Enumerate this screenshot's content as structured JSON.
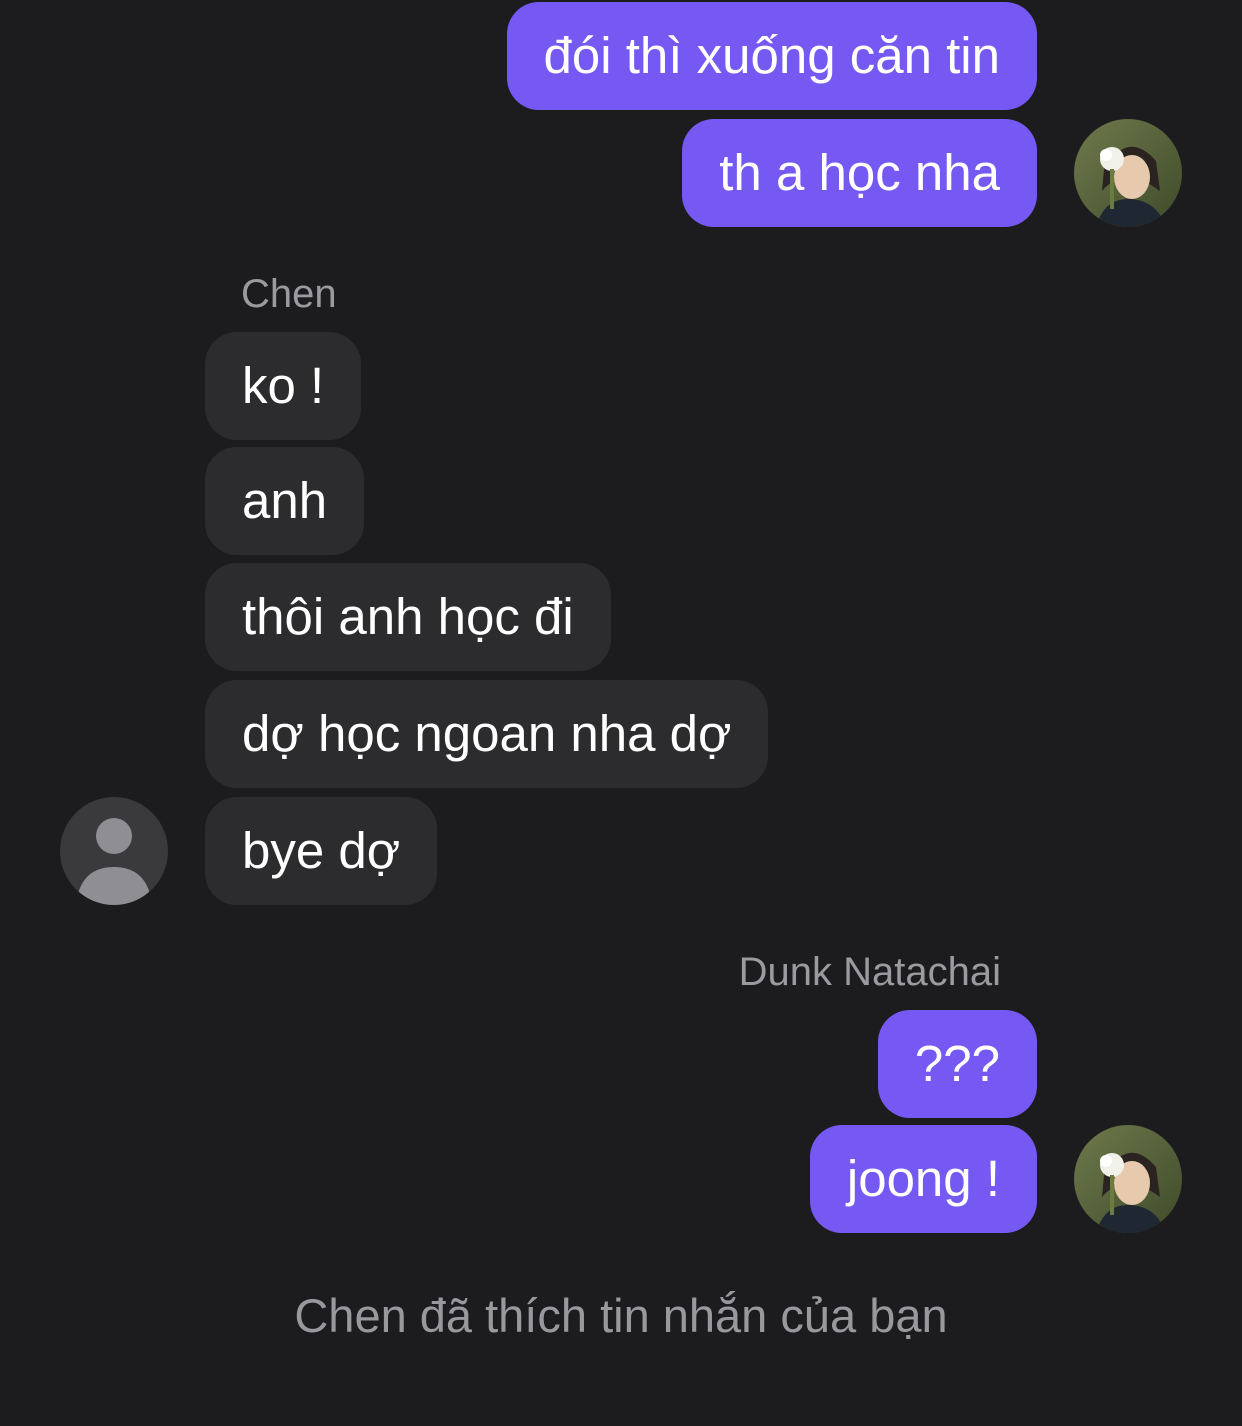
{
  "conversation": {
    "messages": [
      {
        "direction": "outgoing",
        "text": "đói thì xuống căn tin"
      },
      {
        "direction": "outgoing",
        "text": "th a học nha"
      },
      {
        "direction": "incoming",
        "sender": "Chen",
        "text": "ko !"
      },
      {
        "direction": "incoming",
        "text": "anh"
      },
      {
        "direction": "incoming",
        "text": "thôi anh học đi"
      },
      {
        "direction": "incoming",
        "text": "dợ học ngoan nha dợ"
      },
      {
        "direction": "incoming",
        "text": "bye dợ"
      },
      {
        "direction": "outgoing",
        "sender": "Dunk Natachai",
        "text": "???"
      },
      {
        "direction": "outgoing",
        "text": "joong !"
      }
    ],
    "sender_labels": {
      "incoming": "Chen",
      "outgoing": "Dunk Natachai"
    },
    "like_notice": "Chen đã thích tin nhắn của bạn"
  },
  "colors": {
    "background": "#1c1c1e",
    "outgoing_bubble": "#7659f2",
    "incoming_bubble": "#2c2c2e",
    "secondary_text": "#98989d"
  },
  "icons": {
    "incoming_avatar": "default-person-avatar-icon",
    "outgoing_avatar": "profile-photo-avatar"
  }
}
